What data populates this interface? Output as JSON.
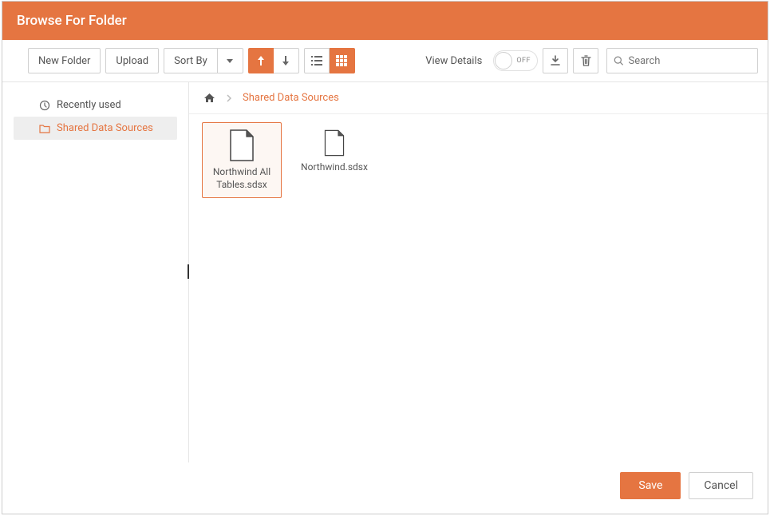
{
  "title": "Browse For Folder",
  "toolbar": {
    "new_folder": "New Folder",
    "upload": "Upload",
    "sort_by": "Sort By",
    "view_details": "View Details",
    "toggle_state": "OFF",
    "search_placeholder": "Search"
  },
  "sidebar": {
    "items": [
      {
        "label": "Recently used",
        "icon": "clock-icon",
        "selected": false
      },
      {
        "label": "Shared Data Sources",
        "icon": "folder-icon",
        "selected": true
      }
    ]
  },
  "breadcrumb": {
    "current": "Shared Data Sources"
  },
  "files": [
    {
      "name": "Northwind All Tables.sdsx",
      "selected": true
    },
    {
      "name": "Northwind.sdsx",
      "selected": false
    }
  ],
  "footer": {
    "save": "Save",
    "cancel": "Cancel"
  },
  "colors": {
    "accent": "#e57541"
  }
}
